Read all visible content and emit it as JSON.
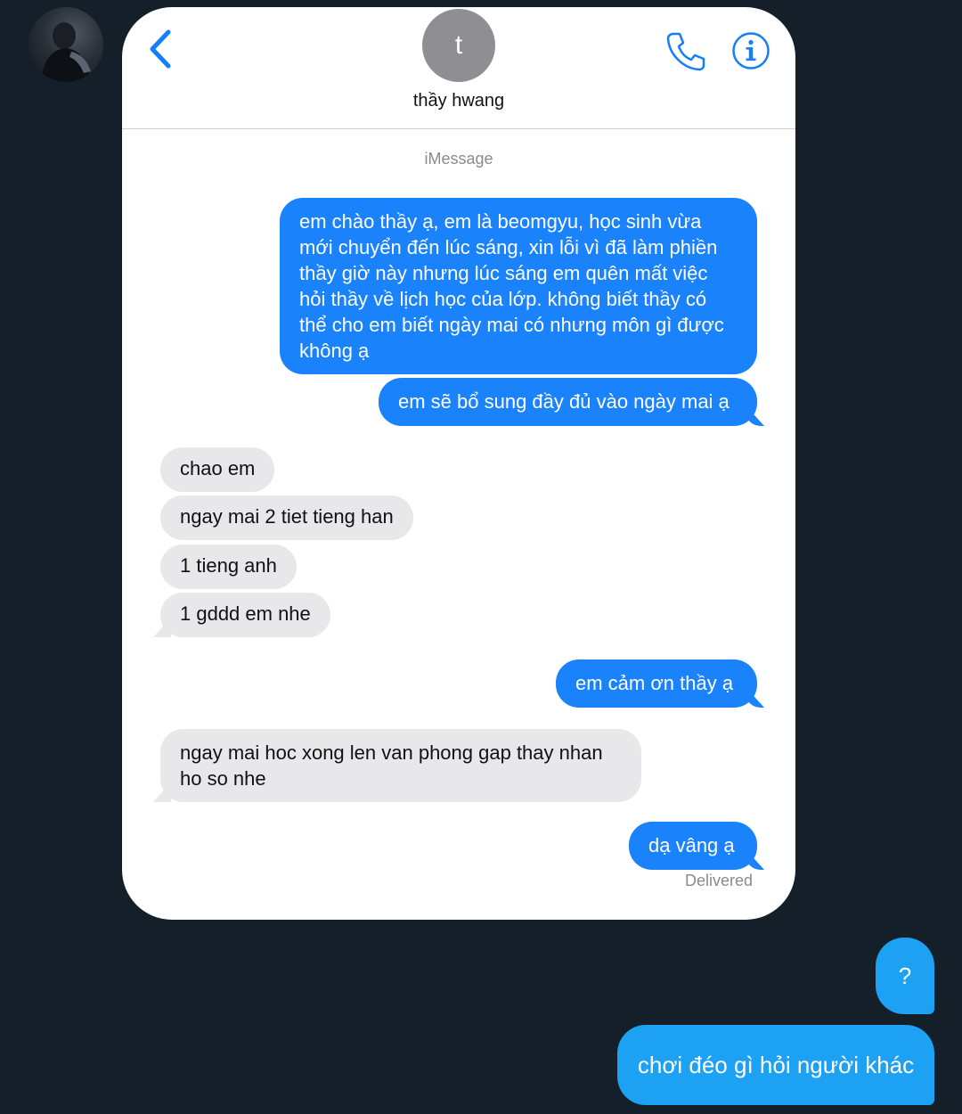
{
  "reply_thread": {
    "messages": [
      {
        "text": "?"
      },
      {
        "text": "chơi đéo gì hỏi người khác"
      }
    ]
  },
  "screenshot": {
    "header": {
      "contact_initial": "t",
      "contact_name": "thầy hwang"
    },
    "service_label": "iMessage",
    "messages": [
      {
        "direction": "out",
        "text": "em chào thầy ạ, em là beomgyu, học sinh vừa mới chuyển đến lúc sáng, xin lỗi vì đã làm phiền thầy giờ này nhưng lúc sáng em quên mất việc hỏi thầy về lịch học của lớp. không biết thầy có thể cho em biết ngày mai có nhưng môn gì được không ạ"
      },
      {
        "direction": "out",
        "text": "em sẽ bổ sung đầy đủ vào ngày mai ạ"
      },
      {
        "direction": "in",
        "text": "chao em"
      },
      {
        "direction": "in",
        "text": "ngay mai 2 tiet tieng han"
      },
      {
        "direction": "in",
        "text": "1 tieng anh"
      },
      {
        "direction": "in",
        "text": "1 gddd em nhe"
      },
      {
        "direction": "out",
        "text": "em cảm ơn thầy ạ"
      },
      {
        "direction": "in",
        "text": "ngay mai hoc xong len van phong gap thay nhan ho so nhe"
      },
      {
        "direction": "out",
        "text": "dạ vâng ạ"
      }
    ],
    "status": "Delivered"
  },
  "colors": {
    "background": "#151f29",
    "outgoing_bubble": "#1a82fb",
    "incoming_bubble": "#e8e8eb",
    "reply_bubble": "#1da1f2",
    "ios_blue": "#147efb"
  },
  "icons": [
    "profile-avatar",
    "back-chevron-icon",
    "phone-icon",
    "info-icon"
  ]
}
